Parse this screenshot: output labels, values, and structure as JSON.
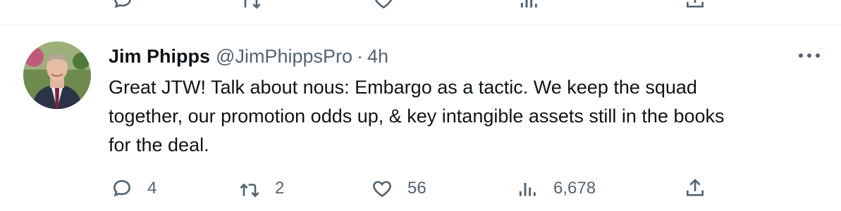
{
  "tweet": {
    "author": {
      "display_name": "Jim Phipps",
      "handle": "@JimPhippsPro",
      "separator": "·",
      "time_ago": "4h"
    },
    "text_lines": [
      "Great JTW! Talk about nous: Embargo as a tactic. We keep the squad",
      "together, our promotion odds up, & key intangible assets still in the books",
      "for the deal."
    ],
    "actions": {
      "replies": "4",
      "retweets": "2",
      "likes": "56",
      "views": "6,678"
    },
    "icons": [
      "reply-icon",
      "retweet-icon",
      "like-icon",
      "views-icon",
      "share-icon",
      "more-icon"
    ]
  }
}
